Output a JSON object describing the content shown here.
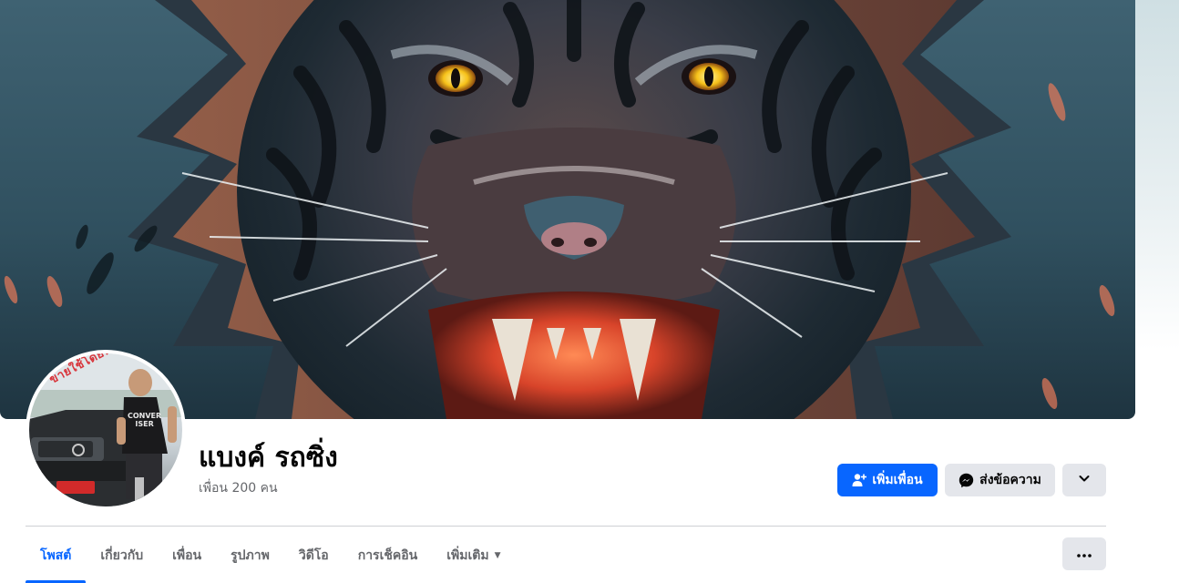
{
  "profile": {
    "name": "แบงค์ รถซิ่ง",
    "friends_count": "เพื่อน 200 คน",
    "avatar_stamp_text": "ขายใช้โดยทอย",
    "avatar_shirt_text_line1": "CONVER",
    "avatar_shirt_text_line2": "ISER"
  },
  "actions": {
    "add_friend_label": "เพิ่มเพื่อน",
    "add_friend_icon": "person-plus-icon",
    "message_label": "ส่งข้อความ",
    "message_icon": "messenger-icon",
    "dropdown_icon": "chevron-down-icon",
    "more_icon": "more-horizontal-icon"
  },
  "tabs": [
    {
      "label": "โพสต์",
      "active": true
    },
    {
      "label": "เกี่ยวกับ",
      "active": false
    },
    {
      "label": "เพื่อน",
      "active": false
    },
    {
      "label": "รูปภาพ",
      "active": false
    },
    {
      "label": "วิดีโอ",
      "active": false
    },
    {
      "label": "การเช็คอิน",
      "active": false
    },
    {
      "label": "เพิ่มเติม",
      "active": false,
      "has_caret": true
    }
  ],
  "colors": {
    "accent": "#0866ff",
    "secondary_button": "#e4e6eb",
    "muted_text": "#65676b",
    "divider": "#ced0d4"
  }
}
